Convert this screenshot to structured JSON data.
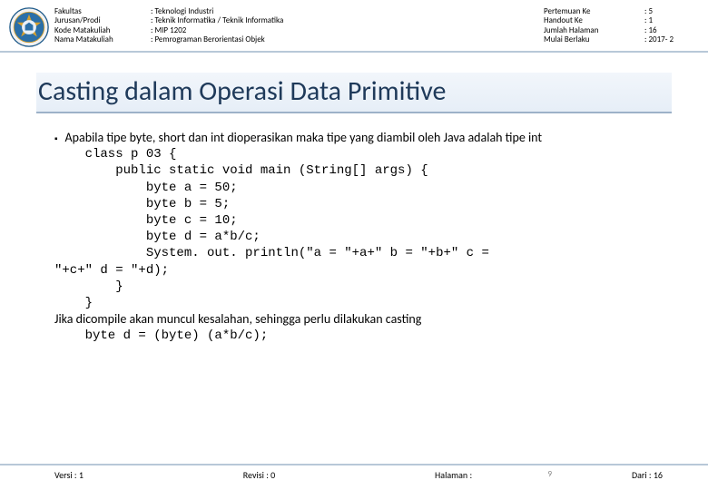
{
  "header": {
    "labels": {
      "fakultas": "Fakultas",
      "jurusan": "Jurusan/Prodi",
      "kode": "Kode Matakuliah",
      "nama": "Nama Matakuliah",
      "pertemuan": "Pertemuan Ke",
      "handout": "Handout Ke",
      "jumlah": "Jumlah Halaman",
      "mulai": "Mulai Berlaku"
    },
    "values": {
      "fakultas": ": Teknologi Industri",
      "jurusan": ": Teknik Informatika / Teknik Informatika",
      "kode": ": MIP 1202",
      "nama": ": Pemrograman Berorientasi Objek",
      "pertemuan": ": 5",
      "handout": ": 1",
      "jumlah": ": 16",
      "mulai": ": 2017- 2"
    }
  },
  "title": "Casting dalam Operasi Data Primitive",
  "body": {
    "intro": "Apabila tipe byte, short dan int dioperasikan maka tipe yang diambil oleh Java adalah tipe int",
    "code": {
      "l1": "    class p 03 {",
      "l2": "        public static void main (String[] args) {",
      "l3": "            byte a = 50;",
      "l4": "            byte b = 5;",
      "l5": "            byte c = 10;",
      "l6": "            byte d = a*b/c;",
      "l7a": "            System. out. println(\"a = \"+a+\" b = \"+b+\" c =",
      "l7b": "\"+c+\" d = \"+d);",
      "l8": "        }",
      "l9": "    }"
    },
    "after": "Jika dicompile akan muncul kesalahan, sehingga perlu dilakukan casting",
    "fix": "    byte d = (byte) (a*b/c);"
  },
  "footer": {
    "versi": "Versi : 1",
    "revisi": "Revisi : 0",
    "halaman": "Halaman :",
    "dari": "Dari : 16",
    "page": "9"
  }
}
